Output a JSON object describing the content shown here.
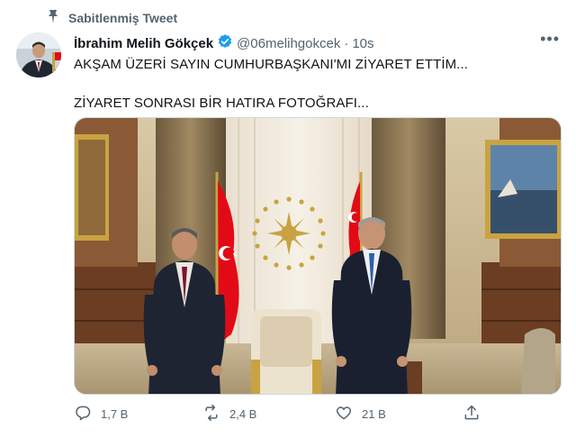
{
  "pinned": {
    "label": "Sabitlenmiş Tweet",
    "icon": "pin-icon"
  },
  "author": {
    "name": "İbrahim Melih Gökçek",
    "verified": true,
    "handle": "@06melihgokcek",
    "separator": "·",
    "time": "10s"
  },
  "tweet": {
    "line1": "AKŞAM ÜZERİ SAYIN CUMHURBAŞKANI'MI ZİYARET ETTİM...",
    "line2": "ZİYARET SONRASI BİR HATIRA FOTOĞRAFI..."
  },
  "actions": {
    "reply": {
      "icon": "reply-icon",
      "count": "1,7 B"
    },
    "retweet": {
      "icon": "retweet-icon",
      "count": "2,4 B"
    },
    "like": {
      "icon": "heart-icon",
      "count": "21 B"
    },
    "share": {
      "icon": "share-icon",
      "count": ""
    }
  },
  "colors": {
    "accent": "#1d9bf0",
    "secondary_text": "#536471",
    "flag_red": "#e30a17"
  }
}
